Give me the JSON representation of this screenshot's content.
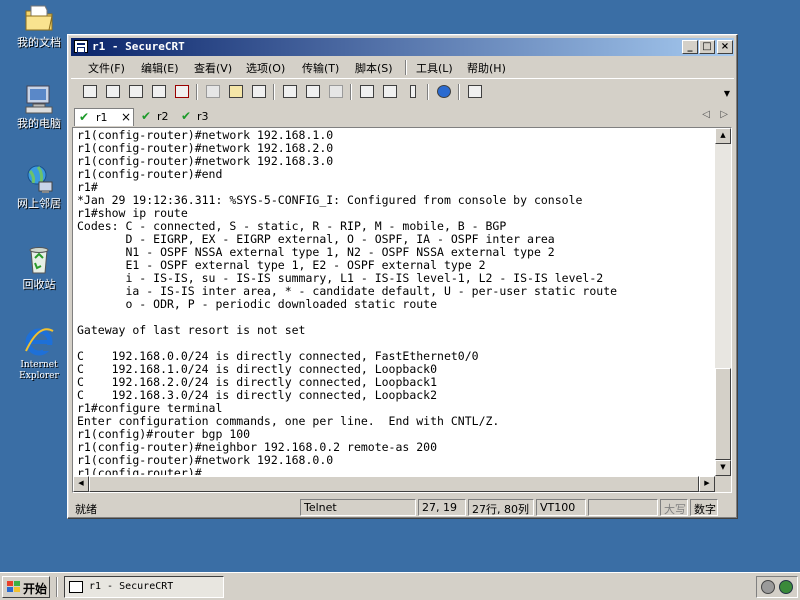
{
  "desktop": {
    "icons": [
      {
        "label": "我的文档",
        "icon": "my-documents-icon"
      },
      {
        "label": "我的电脑",
        "icon": "my-computer-icon"
      },
      {
        "label": "网上邻居",
        "icon": "network-places-icon"
      },
      {
        "label": "回收站",
        "icon": "recycle-bin-icon"
      },
      {
        "label": "Internet Explorer",
        "icon": "internet-explorer-icon"
      }
    ]
  },
  "window": {
    "title": "r1 - SecureCRT",
    "minimize": "_",
    "maximize": "□",
    "close": "×"
  },
  "menu": {
    "items": [
      "文件(F)",
      "编辑(E)",
      "查看(V)",
      "选项(O)",
      "传输(T)",
      "脚本(S)",
      "工具(L)",
      "帮助(H)"
    ]
  },
  "tabs": {
    "items": [
      {
        "label": "r1",
        "close": "×"
      },
      {
        "label": "r2"
      },
      {
        "label": "r3"
      }
    ],
    "prev": "◁",
    "next": "▷"
  },
  "terminal": {
    "lines": [
      "r1(config-router)#network 192.168.1.0",
      "r1(config-router)#network 192.168.2.0",
      "r1(config-router)#network 192.168.3.0",
      "r1(config-router)#end",
      "r1#",
      "*Jan 29 19:12:36.311: %SYS-5-CONFIG_I: Configured from console by console",
      "r1#show ip route",
      "Codes: C - connected, S - static, R - RIP, M - mobile, B - BGP",
      "       D - EIGRP, EX - EIGRP external, O - OSPF, IA - OSPF inter area",
      "       N1 - OSPF NSSA external type 1, N2 - OSPF NSSA external type 2",
      "       E1 - OSPF external type 1, E2 - OSPF external type 2",
      "       i - IS-IS, su - IS-IS summary, L1 - IS-IS level-1, L2 - IS-IS level-2",
      "       ia - IS-IS inter area, * - candidate default, U - per-user static route",
      "       o - ODR, P - periodic downloaded static route",
      "",
      "Gateway of last resort is not set",
      "",
      "C    192.168.0.0/24 is directly connected, FastEthernet0/0",
      "C    192.168.1.0/24 is directly connected, Loopback0",
      "C    192.168.2.0/24 is directly connected, Loopback1",
      "C    192.168.3.0/24 is directly connected, Loopback2",
      "r1#configure terminal",
      "Enter configuration commands, one per line.  End with CNTL/Z.",
      "r1(config)#router bgp 100",
      "r1(config-router)#neighbor 192.168.0.2 remote-as 200",
      "r1(config-router)#network 192.168.0.0",
      "r1(config-router)#"
    ]
  },
  "status": {
    "ready": "就绪",
    "protocol": "Telnet",
    "cursor": "27, 19",
    "size": "27行, 80列",
    "emulation": "VT100",
    "caps": "大写",
    "num": "数字"
  },
  "taskbar": {
    "start": "开始",
    "task": "r1 - SecureCRT"
  },
  "colors": {
    "desktop": "#3a6ea5",
    "titlebar_start": "#0a246a",
    "titlebar_end": "#a6caf0",
    "tab_check": "#1c9a2a"
  }
}
